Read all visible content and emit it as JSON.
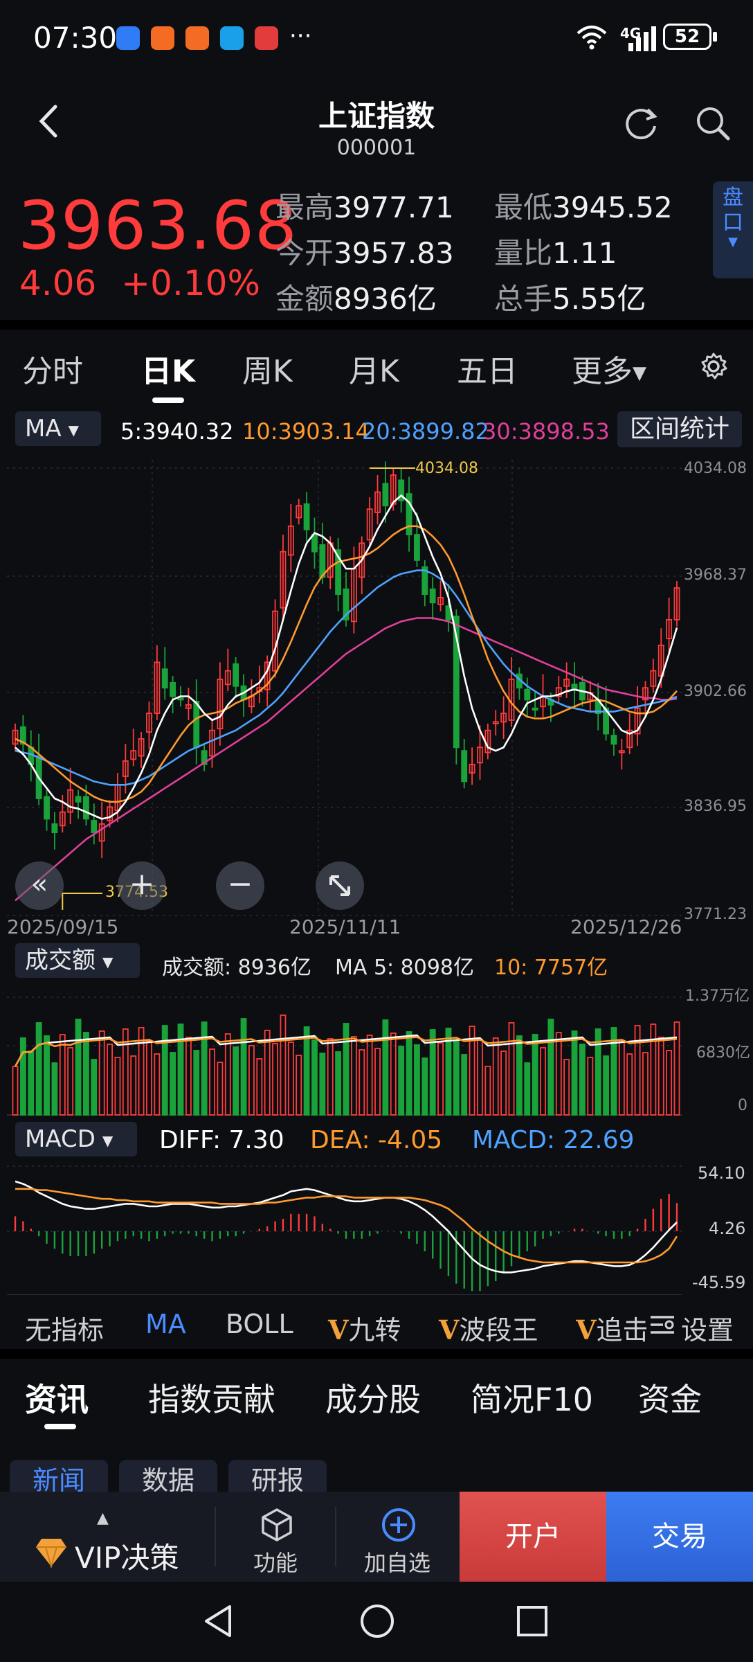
{
  "status_bar": {
    "time": "07:30",
    "more": "···",
    "network": "4G",
    "battery": "52",
    "app_icon_colors": [
      "#2f7cf6",
      "#f46b23",
      "#f46b23",
      "#19a0e8",
      "#e23c3c"
    ]
  },
  "header": {
    "title": "上证指数",
    "code": "000001"
  },
  "quote": {
    "price": "3963.68",
    "change": "4.06",
    "change_pct": "+0.10%",
    "stats": [
      {
        "label": "最高",
        "value": "3977.71"
      },
      {
        "label": "最低",
        "value": "3945.52"
      },
      {
        "label": "今开",
        "value": "3957.83"
      },
      {
        "label": "量比",
        "value": "1.11"
      },
      {
        "label": "金额",
        "value": "8936亿"
      },
      {
        "label": "总手",
        "value": "5.55亿"
      }
    ],
    "pankou_label": "盘口"
  },
  "period_tabs": [
    "分时",
    "日K",
    "周K",
    "月K",
    "五日",
    "更多"
  ],
  "colors": {
    "up": "#ff3b3b",
    "down": "#19a33a",
    "ma5": "#ffffff",
    "ma10": "#ff9a2e",
    "ma20": "#4fa2ff",
    "ma30": "#e0409a",
    "accent_blue": "#4a8bff",
    "annotation": "#f2c84b"
  },
  "kline": {
    "indicator_select": "MA",
    "ma5": "5:3940.32",
    "ma10": "10:3903.14",
    "ma20": "20:3899.82",
    "ma30": "30:3898.53",
    "range_stats_button": "区间统计",
    "y_ticks": [
      "4034.08",
      "3968.37",
      "3902.66",
      "3836.95",
      "3771.23"
    ],
    "x_ticks": [
      "2025/09/15",
      "2025/11/11",
      "2025/12/26"
    ],
    "high_annotation": "4034.08",
    "low_annotation": "3774.53"
  },
  "volume": {
    "indicator_select": "成交额",
    "amount": "成交额: 8936亿",
    "ma5": "MA 5: 8098亿",
    "ma10": "10: 7757亿",
    "y_ticks": [
      "1.37万亿",
      "6830亿",
      "0"
    ]
  },
  "macd": {
    "indicator_select": "MACD",
    "diff": "DIFF: 7.30",
    "dea": "DEA: -4.05",
    "macd": "MACD: 22.69",
    "y_ticks": [
      "54.10",
      "4.26",
      "-45.59"
    ]
  },
  "indicator_tabs": [
    "无指标",
    "MA",
    "BOLL",
    "九转",
    "波段王",
    "追击"
  ],
  "indicator_settings": "设置",
  "info_tabs": [
    "资讯",
    "指数贡献",
    "成分股",
    "简况F10",
    "资金"
  ],
  "info_subtabs": [
    "新闻",
    "数据",
    "研报"
  ],
  "action_bar": {
    "vip": "VIP决策",
    "function": "功能",
    "add_watch": "加自选",
    "open_account": "开户",
    "trade": "交易"
  },
  "chart_data": {
    "type": "candlestick",
    "title": "上证指数",
    "x_labels": [
      "2025/09/15",
      "2025/11/11",
      "2025/12/26"
    ],
    "ylim": [
      3771.23,
      4034.08
    ],
    "series": [
      {
        "name": "close",
        "values": [
          3880,
          3872,
          3860,
          3840,
          3828,
          3820,
          3832,
          3845,
          3838,
          3828,
          3820,
          3825,
          3835,
          3848,
          3862,
          3868,
          3875,
          3890,
          3920,
          3905,
          3900,
          3898,
          3895,
          3870,
          3860,
          3880,
          3910,
          3915,
          3906,
          3898,
          3900,
          3905,
          3920,
          3950,
          3985,
          4000,
          4012,
          3998,
          3985,
          3970,
          3990,
          3960,
          3945,
          3975,
          3990,
          4010,
          4020,
          4012,
          4030,
          4015,
          3995,
          3980,
          3960,
          3955,
          3958,
          3945,
          3870,
          3850,
          3860,
          3870,
          3880,
          3885,
          3890,
          3910,
          3905,
          3898,
          3892,
          3900,
          3895,
          3905,
          3910,
          3904,
          3898,
          3902,
          3890,
          3878,
          3872,
          3868,
          3880,
          3893,
          3905,
          3915,
          3930,
          3945,
          3963.68
        ]
      },
      {
        "name": "MA5",
        "values": [
          3870,
          3866,
          3860,
          3852,
          3846,
          3840,
          3838,
          3835,
          3834,
          3832,
          3830,
          3828,
          3829,
          3832,
          3838,
          3846,
          3855,
          3866,
          3880,
          3890,
          3898,
          3900,
          3900,
          3896,
          3890,
          3886,
          3888,
          3895,
          3900,
          3902,
          3905,
          3908,
          3915,
          3928,
          3945,
          3962,
          3978,
          3990,
          3996,
          3994,
          3990,
          3982,
          3975,
          3975,
          3980,
          3988,
          3998,
          4006,
          4014,
          4018,
          4014,
          4006,
          3994,
          3982,
          3972,
          3958,
          3935,
          3912,
          3893,
          3880,
          3870,
          3868,
          3870,
          3878,
          3888,
          3896,
          3898,
          3900,
          3900,
          3901,
          3903,
          3904,
          3903,
          3902,
          3898,
          3892,
          3886,
          3880,
          3878,
          3880,
          3888,
          3898,
          3910,
          3925,
          3940.32
        ]
      },
      {
        "name": "MA10",
        "values": [
          3875,
          3873,
          3870,
          3866,
          3862,
          3858,
          3854,
          3850,
          3847,
          3844,
          3841,
          3839,
          3838,
          3838,
          3839,
          3841,
          3844,
          3849,
          3856,
          3863,
          3870,
          3877,
          3883,
          3887,
          3889,
          3890,
          3891,
          3893,
          3896,
          3898,
          3900,
          3903,
          3907,
          3913,
          3922,
          3932,
          3943,
          3954,
          3964,
          3971,
          3976,
          3979,
          3980,
          3981,
          3982,
          3984,
          3987,
          3991,
          3995,
          3998,
          4000,
          4000,
          3998,
          3994,
          3989,
          3982,
          3972,
          3960,
          3947,
          3935,
          3922,
          3912,
          3903,
          3896,
          3891,
          3888,
          3887,
          3887,
          3888,
          3890,
          3892,
          3894,
          3896,
          3897,
          3898,
          3897,
          3895,
          3893,
          3891,
          3890,
          3890,
          3891,
          3894,
          3898,
          3903.14
        ]
      },
      {
        "name": "MA20",
        "values": [
          3868,
          3867,
          3866,
          3864,
          3862,
          3860,
          3858,
          3856,
          3854,
          3852,
          3850,
          3849,
          3848,
          3848,
          3848,
          3849,
          3851,
          3853,
          3856,
          3859,
          3862,
          3865,
          3868,
          3870,
          3872,
          3874,
          3876,
          3878,
          3880,
          3883,
          3886,
          3889,
          3893,
          3897,
          3902,
          3908,
          3914,
          3920,
          3926,
          3932,
          3938,
          3943,
          3948,
          3952,
          3956,
          3960,
          3964,
          3967,
          3970,
          3972,
          3973,
          3974,
          3974,
          3972,
          3969,
          3965,
          3959,
          3952,
          3945,
          3938,
          3931,
          3925,
          3919,
          3914,
          3910,
          3906,
          3903,
          3900,
          3898,
          3896,
          3894,
          3893,
          3892,
          3891,
          3891,
          3891,
          3891,
          3892,
          3893,
          3894,
          3895,
          3896,
          3897,
          3898,
          3899.82
        ]
      },
      {
        "name": "MA30",
        "values": [
          3780,
          3784,
          3788,
          3792,
          3796,
          3800,
          3804,
          3808,
          3812,
          3816,
          3819,
          3822,
          3825,
          3828,
          3831,
          3834,
          3837,
          3840,
          3843,
          3846,
          3849,
          3852,
          3855,
          3858,
          3861,
          3864,
          3867,
          3870,
          3873,
          3876,
          3879,
          3882,
          3885,
          3889,
          3893,
          3897,
          3901,
          3905,
          3909,
          3913,
          3917,
          3921,
          3925,
          3928,
          3931,
          3934,
          3937,
          3940,
          3942,
          3944,
          3945,
          3946,
          3946,
          3946,
          3945,
          3944,
          3942,
          3940,
          3938,
          3936,
          3934,
          3932,
          3930,
          3928,
          3926,
          3924,
          3922,
          3920,
          3918,
          3916,
          3914,
          3912,
          3910,
          3908,
          3906,
          3904,
          3903,
          3902,
          3901,
          3900,
          3899,
          3899,
          3898,
          3898,
          3898.53
        ]
      },
      {
        "name": "MACD DIFF",
        "values": [
          40,
          38,
          35,
          31,
          28,
          25,
          22,
          20,
          19,
          18,
          18,
          19,
          20,
          21,
          22,
          22,
          21,
          20,
          20,
          21,
          22,
          22,
          22,
          21,
          20,
          19,
          19,
          20,
          20,
          21,
          22,
          23,
          25,
          27,
          29,
          32,
          33,
          34,
          33,
          31,
          29,
          27,
          25,
          24,
          24,
          25,
          26,
          27,
          27,
          26,
          24,
          21,
          17,
          12,
          6,
          0,
          -8,
          -15,
          -22,
          -27,
          -30,
          -32,
          -33,
          -33,
          -32,
          -31,
          -30,
          -28,
          -27,
          -26,
          -25,
          -24,
          -24,
          -25,
          -26,
          -27,
          -28,
          -28,
          -27,
          -24,
          -19,
          -13,
          -6,
          1,
          7.3
        ]
      },
      {
        "name": "MACD DEA",
        "values": [
          34,
          34,
          34,
          33,
          33,
          32,
          31,
          30,
          29,
          28,
          27,
          26,
          26,
          25,
          25,
          24,
          24,
          24,
          23,
          23,
          23,
          23,
          23,
          23,
          23,
          23,
          22,
          22,
          22,
          22,
          22,
          22,
          23,
          23,
          24,
          25,
          26,
          27,
          27,
          28,
          28,
          28,
          28,
          27,
          27,
          27,
          27,
          27,
          27,
          27,
          27,
          26,
          25,
          23,
          21,
          18,
          13,
          8,
          2,
          -3,
          -8,
          -12,
          -16,
          -19,
          -21,
          -23,
          -24,
          -25,
          -25,
          -25,
          -25,
          -25,
          -25,
          -25,
          -25,
          -25,
          -25,
          -25,
          -25,
          -25,
          -24,
          -22,
          -19,
          -14,
          -4.05
        ]
      },
      {
        "name": "MACD",
        "values": [
          12,
          8,
          2,
          -4,
          -10,
          -14,
          -18,
          -20,
          -20,
          -20,
          -18,
          -14,
          -12,
          -8,
          -6,
          -4,
          -6,
          -8,
          -6,
          -4,
          -2,
          -2,
          -2,
          -4,
          -6,
          -8,
          -6,
          -4,
          -4,
          -2,
          0,
          2,
          4,
          8,
          10,
          14,
          14,
          14,
          12,
          6,
          2,
          -2,
          -6,
          -6,
          -6,
          -4,
          -2,
          0,
          0,
          -2,
          -6,
          -10,
          -16,
          -22,
          -30,
          -36,
          -42,
          -46,
          -48,
          -48,
          -44,
          -40,
          -34,
          -28,
          -22,
          -16,
          -12,
          -6,
          -4,
          -2,
          0,
          2,
          2,
          0,
          -2,
          -4,
          -6,
          -6,
          -4,
          2,
          10,
          18,
          26,
          30,
          22.69
        ]
      }
    ]
  }
}
